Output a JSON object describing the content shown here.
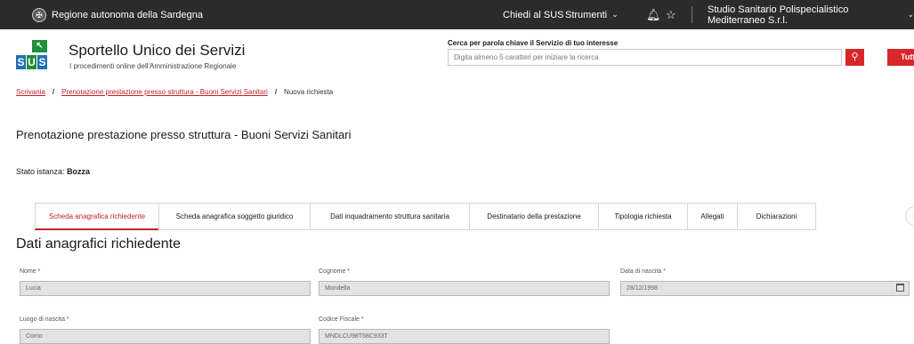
{
  "topbar": {
    "region_name": "Regione autonoma della Sardegna",
    "help": "Chiedi al SUS",
    "tools": "Strumenti",
    "organization": "Studio Sanitario Polispecialistico Mediterraneo S.r.l."
  },
  "icons": {
    "bell": "bell-icon",
    "star": "star-icon",
    "search": "search-icon",
    "calendar": "calendar-icon",
    "chevron": "chevron-down-icon",
    "next": "chevron-right-icon"
  },
  "colors": {
    "accent": "#d9262b",
    "topbar": "#2b2b2b",
    "logo_green": "#1f8f3a",
    "logo_blue": "#1f6fb5"
  },
  "header": {
    "logo_letters": [
      "S",
      "U",
      "S"
    ],
    "title": "Sportello Unico dei Servizi",
    "subtitle": "I procedimenti online dell'Amministrazione Regionale",
    "search_label": "Cerca per parola chiave il Servizio di tuo interesse",
    "search_placeholder": "Digita almeno 5 caratteri per iniziare la ricerca",
    "all_button": "Tutti"
  },
  "breadcrumb": {
    "home": "Scrivania",
    "parent": "Prenotazione prestazione presso struttura - Buoni Servizi Sanitari",
    "current": "Nuova richiesta",
    "separator": "/"
  },
  "page_title": "Prenotazione prestazione presso struttura - Buoni Servizi Sanitari",
  "status": {
    "label": "Stato istanza:",
    "value": "Bozza"
  },
  "tabs": [
    "Scheda anagrafica richiedente",
    "Scheda anagrafica soggetto giuridico",
    "Dati inquadramento struttura sanitaria",
    "Destinatario della prestazione",
    "Tipologia richiesta",
    "Allegati",
    "Dichiarazioni"
  ],
  "section_title": "Dati anagrafici richiedente",
  "fields": {
    "nome": {
      "label": "Nome *",
      "value": "Lucia"
    },
    "cognome": {
      "label": "Cognome *",
      "value": "Mondella"
    },
    "data_nascita": {
      "label": "Data di nascita *",
      "value": "28/12/1998"
    },
    "luogo_nascita": {
      "label": "Luogo di nascita *",
      "value": "Como"
    },
    "codice_fiscale": {
      "label": "Codice Fiscale *",
      "value": "MNDLCU98T68C933T"
    }
  }
}
